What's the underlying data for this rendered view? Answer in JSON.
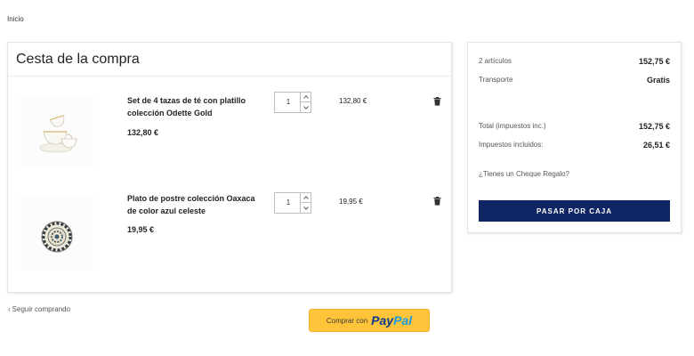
{
  "breadcrumb": {
    "home": "Inicio"
  },
  "cart": {
    "title": "Cesta de la compra",
    "items": [
      {
        "name": "Set de 4 tazas de té con platillo colección Odette Gold",
        "unit_price": "132,80 €",
        "quantity": "1",
        "line_total": "132,80 €",
        "image_icon": "cups-saucer-icon"
      },
      {
        "name": "Plato de postre colección Oaxaca de color azul celeste",
        "unit_price": "19,95 €",
        "quantity": "1",
        "line_total": "19,95 €",
        "image_icon": "blue-plate-icon"
      }
    ],
    "continue_label": "Seguir comprando"
  },
  "summary": {
    "items_label": "2 artículos",
    "items_value": "152,75 €",
    "shipping_label": "Transporte",
    "shipping_value": "Gratis",
    "total_label": "Total (impuestos inc.)",
    "total_value": "152,75 €",
    "taxes_label": "Impuestos incluidos:",
    "taxes_value": "26,51 €",
    "gift_label": "¿Tienes un Cheque Regalo?",
    "checkout_label": "PASAR POR CAJA"
  },
  "paypal": {
    "prefix": "Comprar con",
    "logo_pay": "Pay",
    "logo_pal": "Pal"
  },
  "colors": {
    "checkout_bg": "#0f2564",
    "paypal_bg": "#ffc43a",
    "paypal_dark": "#0b3a8e",
    "paypal_light": "#1b9ce3"
  }
}
